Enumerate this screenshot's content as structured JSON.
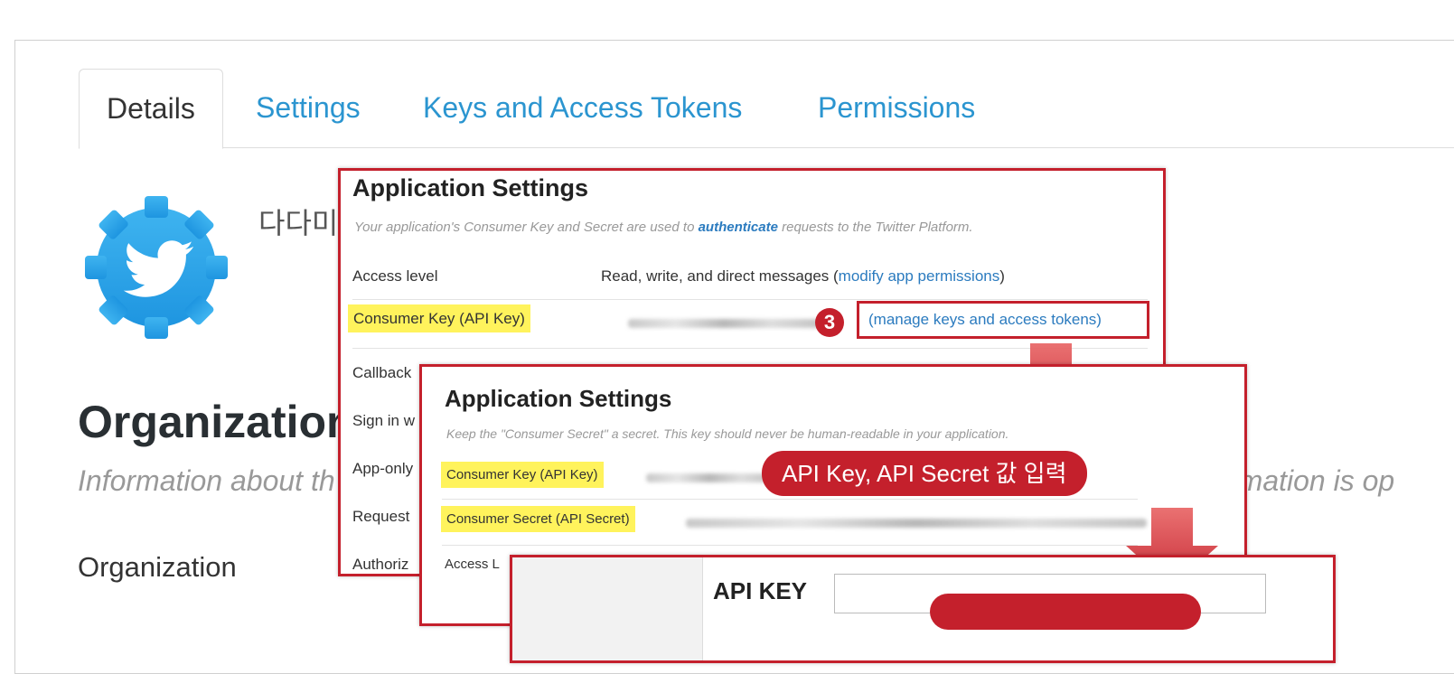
{
  "tabs": [
    "Details",
    "Settings",
    "Keys and Access Tokens",
    "Permissions"
  ],
  "app": {
    "name": "다다미",
    "logo_icon": "twitter-bird-gear-icon"
  },
  "organization": {
    "heading": "Organization",
    "description": "Information about th",
    "description_tail": "rmation is op",
    "label": "Organization"
  },
  "panel1": {
    "title": "Application Settings",
    "subtitle_pre": "Your application's Consumer Key and Secret are used to ",
    "subtitle_link": "authenticate",
    "subtitle_post": " requests to the Twitter Platform.",
    "access_level_label": "Access level",
    "access_level_value": "Read, write, and direct messages (",
    "access_level_link": "modify app permissions",
    "access_level_close": ")",
    "consumer_key_label": "Consumer Key (API Key)",
    "manage_link": "(manage keys and access tokens)",
    "step_number": "3",
    "truncated_rows": [
      "Callback",
      "Sign in w",
      "App-only",
      "Request",
      "Authoriz"
    ]
  },
  "panel2": {
    "title": "Application Settings",
    "subtitle": "Keep the \"Consumer Secret\" a secret. This key should never be human-readable in your application.",
    "consumer_key_label": "Consumer Key (API Key)",
    "consumer_secret_label": "Consumer Secret (API Secret)",
    "truncated_row": "Access L",
    "callout": "API Key, API Secret 값 입력"
  },
  "panel3": {
    "api_key_label": "API KEY"
  },
  "colors": {
    "accent_red": "#c4202c",
    "link_blue": "#2b95d0",
    "highlight": "#fff35c"
  }
}
